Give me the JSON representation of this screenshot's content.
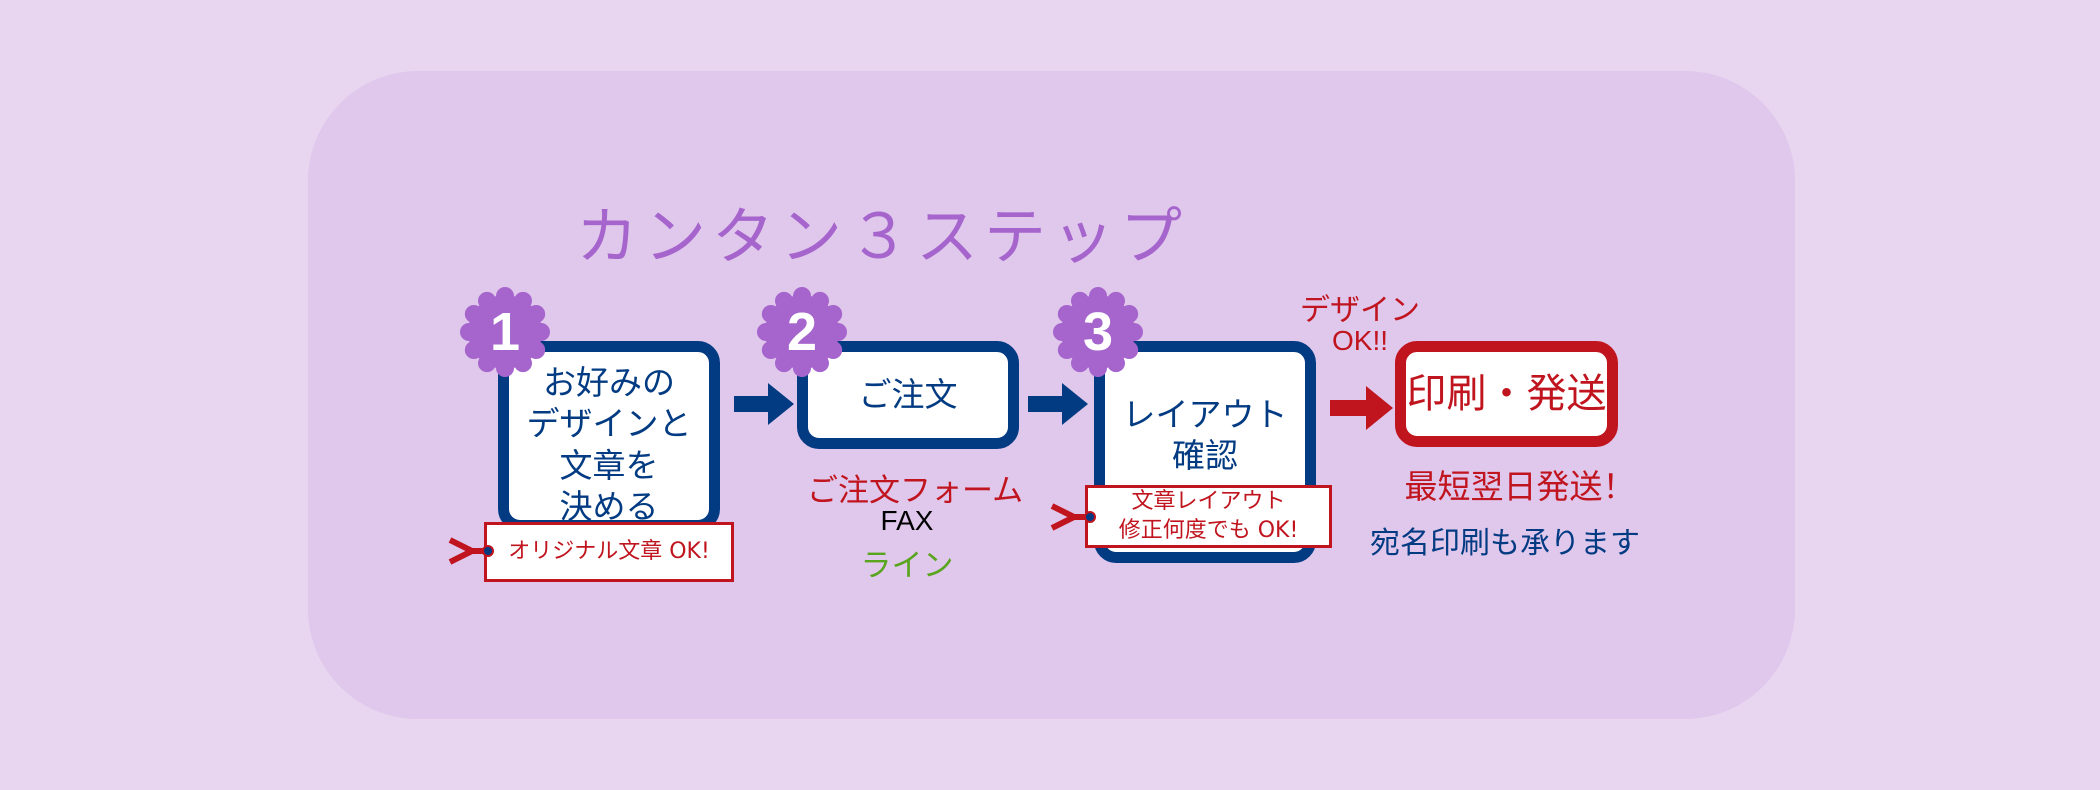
{
  "title": "カンタン３ステップ",
  "colors": {
    "navy": "#033b83",
    "red": "#c0141e",
    "purple": "#a665cc",
    "green": "#5aa51e",
    "panel": "#e0c7ec",
    "background": "#e8d6f1"
  },
  "steps": [
    {
      "number": "1",
      "lines": [
        "お好みの",
        "デザインと",
        "文章を",
        "決める"
      ],
      "tag": [
        "オリジナル文章 OK!"
      ]
    },
    {
      "number": "2",
      "lines": [
        "ご注文"
      ],
      "notes": {
        "form": "ご注文フォーム",
        "fax": "FAX",
        "line": "ライン"
      }
    },
    {
      "number": "3",
      "lines": [
        "レイアウト",
        "確認"
      ],
      "tag": [
        "文章レイアウト",
        "修正何度でも OK!"
      ]
    },
    {
      "lines": [
        "印刷・発送"
      ],
      "above": [
        "デザイン",
        "OK!!"
      ],
      "notes": {
        "fast": "最短翌日発送！",
        "address": "宛名印刷も承ります"
      }
    }
  ]
}
